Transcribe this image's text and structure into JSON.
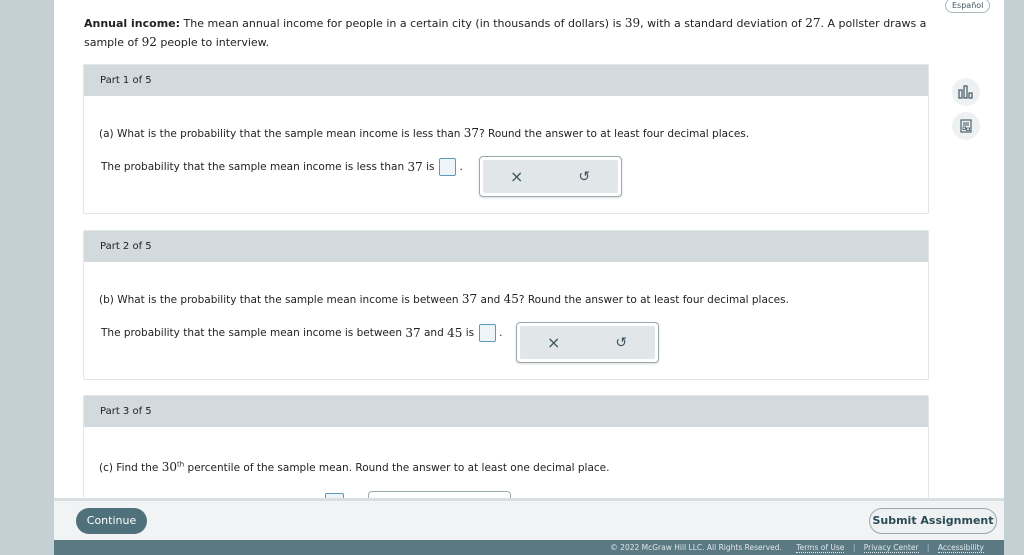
{
  "language_toggle": "Español",
  "problem": {
    "label": "Annual income:",
    "text_before_mean": "The mean annual income for people in a certain city (in thousands of dollars) is",
    "mean": "39",
    "text_before_sd": ", with a standard deviation of",
    "sd": "27",
    "text_before_n": ". A pollster draws a sample of",
    "n": "92",
    "text_end": "people to interview."
  },
  "tools": [
    {
      "name": "data-chart-icon"
    },
    {
      "name": "calculator-sheet-icon"
    }
  ],
  "parts": [
    {
      "header": "Part 1 of 5",
      "question_pre": "(a) What is the probability that the sample mean income is less than",
      "question_num": "37",
      "question_post": "? Round the answer to at least four decimal places.",
      "answer_pre": "The probability that the sample mean income is less than",
      "answer_num": "37",
      "answer_post": "is",
      "answer_value": ""
    },
    {
      "header": "Part 2 of 5",
      "question_pre": "(b) What is the probability that the sample mean income is between",
      "question_num1": "37",
      "question_mid": "and",
      "question_num2": "45",
      "question_post": "? Round the answer to at least four decimal places.",
      "answer_pre": "The probability that the sample mean income is between",
      "answer_num1": "37",
      "answer_mid": "and",
      "answer_num2": "45",
      "answer_post": "is",
      "answer_value": ""
    },
    {
      "header": "Part 3 of 5",
      "question_pre": "(c) Find the",
      "question_num": "30",
      "question_sup": "th",
      "question_post": "percentile of the sample mean. Round the answer to at least one decimal place."
    }
  ],
  "widget": {
    "clear_symbol": "×",
    "undo_symbol": "↺"
  },
  "bottom": {
    "continue_label": "Continue",
    "submit_label": "Submit Assignment"
  },
  "footer": {
    "copyright": "© 2022 McGraw Hill LLC. All Rights Reserved.",
    "links": [
      "Terms of Use",
      "Privacy Center",
      "Accessibility"
    ]
  },
  "colors": {
    "accent": "#4f717c",
    "header_bg": "#d2dadd",
    "footer_bg": "#5b7983",
    "answer_border": "#5b9ab8"
  }
}
